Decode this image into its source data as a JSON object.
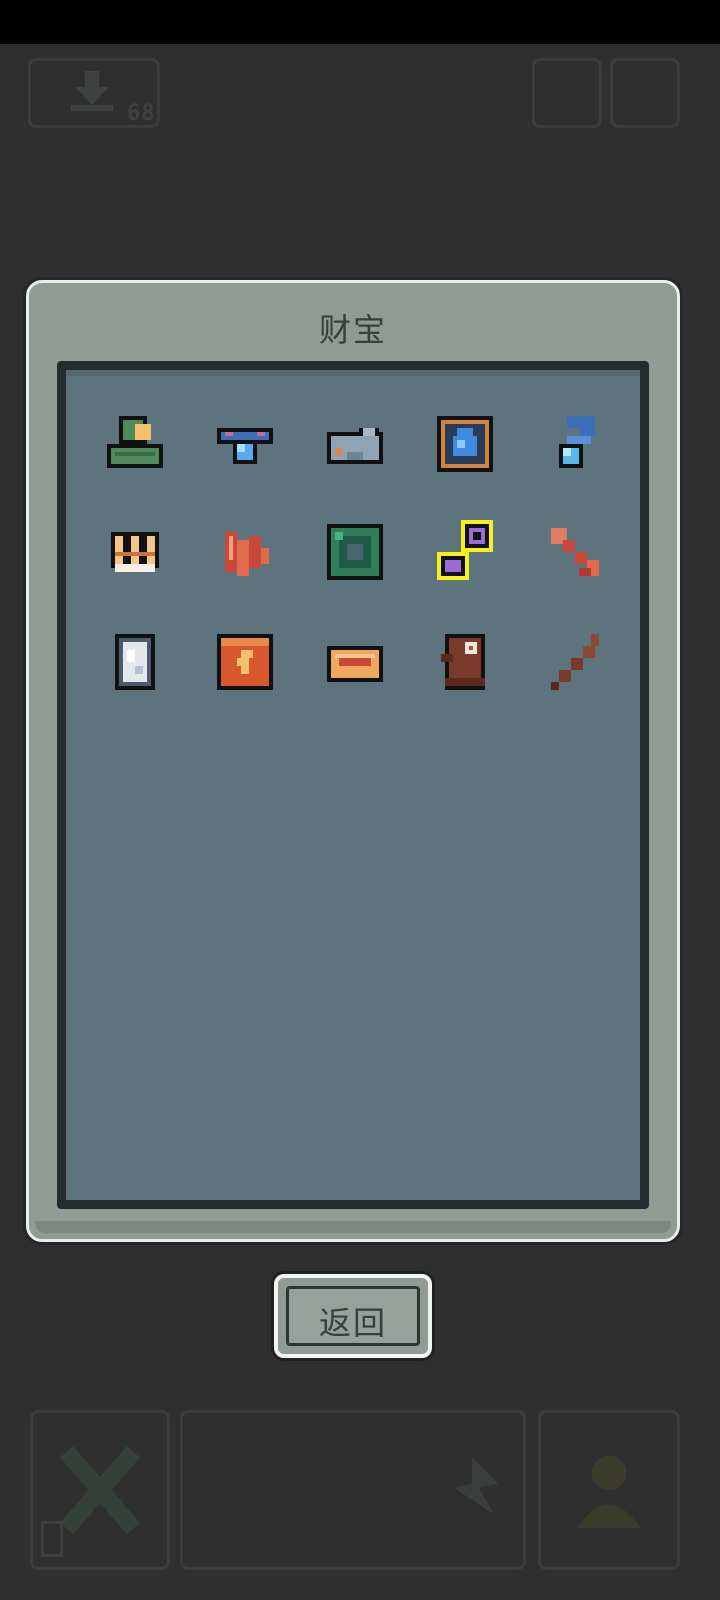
{
  "hud": {
    "download_count": "68"
  },
  "dialog": {
    "title": "财宝",
    "items": [
      {
        "icon": "green-hood-icon"
      },
      {
        "icon": "blue-amulet-icon"
      },
      {
        "icon": "gray-cannon-icon"
      },
      {
        "icon": "water-tome-icon"
      },
      {
        "icon": "blue-spirit-icon"
      },
      {
        "icon": "golden-crown-icon"
      },
      {
        "icon": "red-feather-icon"
      },
      {
        "icon": "green-gem-block-icon"
      },
      {
        "icon": "purple-key-icon"
      },
      {
        "icon": "red-arrow-icon"
      },
      {
        "icon": "silver-mirror-icon"
      },
      {
        "icon": "lightning-cloth-icon"
      },
      {
        "icon": "orange-lozenge-icon"
      },
      {
        "icon": "brown-totem-icon"
      },
      {
        "icon": "brown-stick-icon"
      }
    ],
    "selected_index": 8
  },
  "back_button": {
    "label": "返回"
  }
}
